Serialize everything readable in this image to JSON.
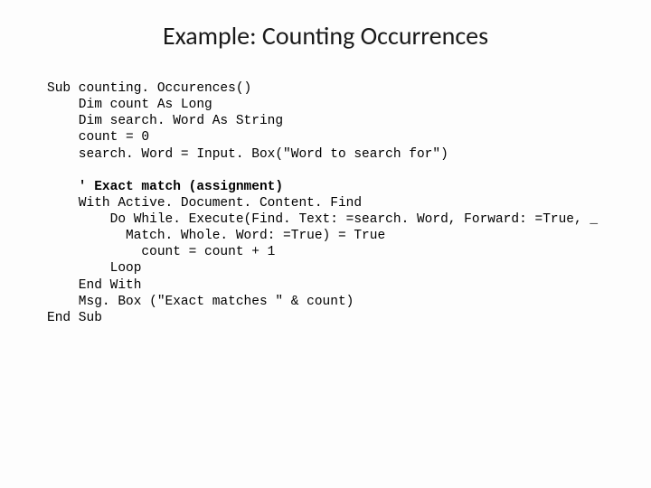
{
  "title": "Example: Counting Occurrences",
  "code": {
    "l1": "Sub counting. Occurences()",
    "l2": "    Dim count As Long",
    "l3": "    Dim search. Word As String",
    "l4": "    count = 0",
    "l5": "    search. Word = Input. Box(\"Word to search for\")",
    "l6": "",
    "l7": "    ' Exact match (assignment)",
    "l8": "    With Active. Document. Content. Find",
    "l9": "        Do While. Execute(Find. Text: =search. Word, Forward: =True, _",
    "l10": "          Match. Whole. Word: =True) = True",
    "l11": "            count = count + 1",
    "l12": "        Loop",
    "l13": "    End With",
    "l14": "    Msg. Box (\"Exact matches \" & count)",
    "l15": "End Sub"
  }
}
